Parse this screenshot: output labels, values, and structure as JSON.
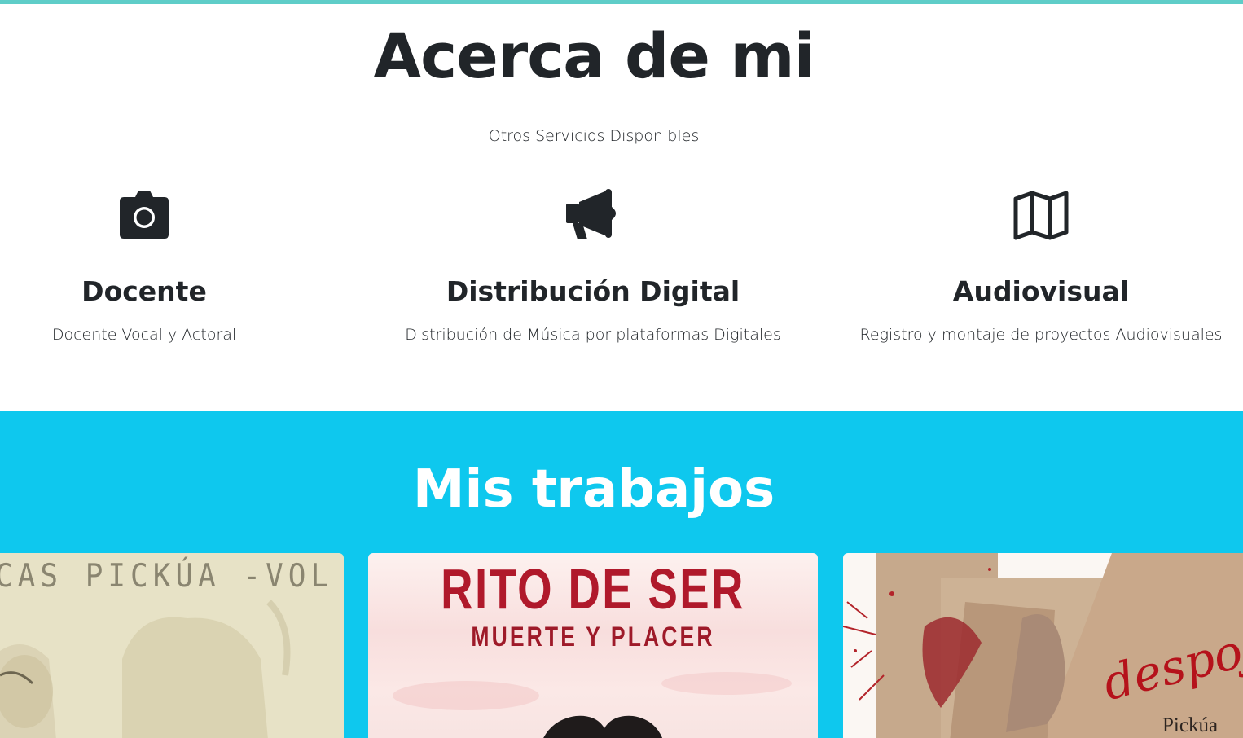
{
  "about": {
    "title": "Acerca de mi",
    "subtitle": "Otros Servicios Disponibles",
    "services": [
      {
        "icon": "camera-icon",
        "title": "Docente",
        "description": "Docente Vocal y Actoral"
      },
      {
        "icon": "megaphone-icon",
        "title": "Distribución Digital",
        "description": "Distribución de Música por plataformas Digitales"
      },
      {
        "icon": "map-icon",
        "title": "Audiovisual",
        "description": "Registro y montaje de proyectos Audiovisuales"
      }
    ]
  },
  "works": {
    "title": "Mis trabajos",
    "cards": [
      {
        "cover_text": "CAS PICKÚA -VOL II"
      },
      {
        "cover_title": "RITO DE SER",
        "cover_subtitle": "MUERTE Y PLACER"
      },
      {
        "cover_script": "despoj",
        "cover_artist": "Pickúa"
      }
    ]
  },
  "colors": {
    "top_border": "#5fcdc8",
    "works_background": "#0ec8ee",
    "text_dark": "#212529"
  }
}
